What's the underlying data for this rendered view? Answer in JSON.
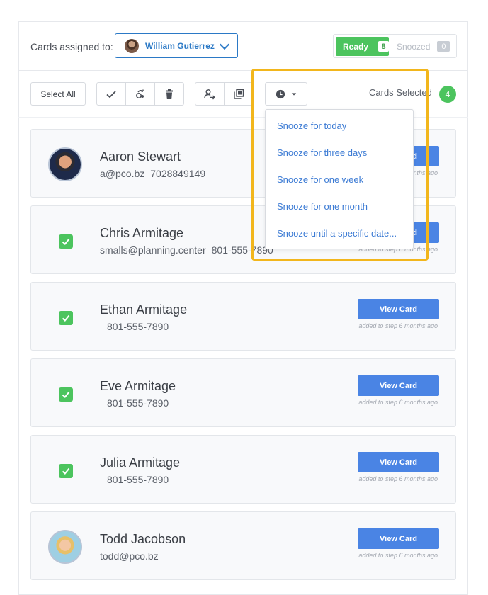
{
  "header": {
    "assigned_label": "Cards assigned to:",
    "assignee_name": "William Gutierrez",
    "tabs": [
      {
        "label": "Ready",
        "count": "8"
      },
      {
        "label": "Snoozed",
        "count": "0"
      }
    ]
  },
  "toolbar": {
    "select_all": "Select All",
    "cards_selected_label": "Cards Selected",
    "cards_selected_count": "4",
    "icons": [
      "check-icon",
      "reassign-icon",
      "trash-icon",
      "send-to-person-icon",
      "copy-cards-icon",
      "clock-icon"
    ]
  },
  "snooze_menu": {
    "items": [
      "Snooze for today",
      "Snooze for three days",
      "Snooze for one week",
      "Snooze for one month",
      "Snooze until a specific date..."
    ]
  },
  "cards": [
    {
      "name": "Aaron Stewart",
      "email": "a@pco.bz",
      "phone": "7028849149",
      "view_label": "View Card",
      "added": "added to step 6 months ago",
      "selected": false
    },
    {
      "name": "Chris Armitage",
      "email": "smalls@planning.center",
      "phone": "801-555-7890",
      "view_label": "View Card",
      "added": "added to step 6 months ago",
      "selected": true
    },
    {
      "name": "Ethan Armitage",
      "email": "",
      "phone": "801-555-7890",
      "view_label": "View Card",
      "added": "added to step 6 months ago",
      "selected": true
    },
    {
      "name": "Eve Armitage",
      "email": "",
      "phone": "801-555-7890",
      "view_label": "View Card",
      "added": "added to step 6 months ago",
      "selected": true
    },
    {
      "name": "Julia Armitage",
      "email": "",
      "phone": "801-555-7890",
      "view_label": "View Card",
      "added": "added to step 6 months ago",
      "selected": true
    },
    {
      "name": "Todd Jacobson",
      "email": "todd@pco.bz",
      "phone": "",
      "view_label": "View Card",
      "added": "added to step 6 months ago",
      "selected": false
    }
  ],
  "colors": {
    "accent_blue": "#4a84e4",
    "link_blue": "#3c7bd4",
    "green": "#4cc45e",
    "highlight": "#f2b61c"
  }
}
